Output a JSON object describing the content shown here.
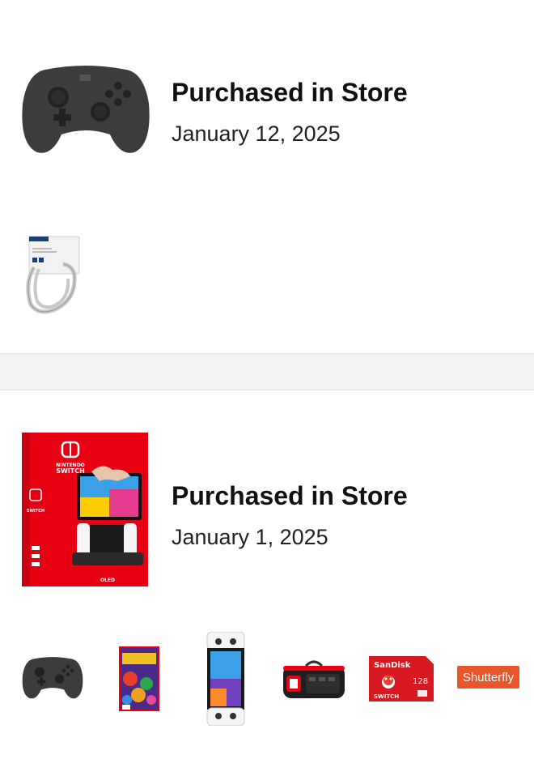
{
  "orders": [
    {
      "title": "Purchased in Store",
      "date": "January 12, 2025",
      "main_product_icon": "pro-controller",
      "items": [
        "ethernet-cable-product"
      ]
    },
    {
      "title": "Purchased in Store",
      "date": "January 1, 2025",
      "main_product_icon": "nintendo-switch-oled-box",
      "box_brand": "NINTENDO SWITCH",
      "box_model": "OLED",
      "items": [
        "pro-controller",
        "mario-kart-8-deluxe-game",
        "switch-oled-console",
        "switch-carry-case",
        "sandisk-microsd-card",
        "shutterfly-gift-card"
      ],
      "sd_brand": "SanDisk",
      "sd_capacity": "128",
      "sd_platform": "SWITCH",
      "shutterfly_label": "Shutterfly"
    }
  ],
  "colors": {
    "box_red": "#e60012",
    "shutterfly_orange": "#e8562a",
    "controller": "#3a3c3e",
    "sandisk_red": "#d71921"
  }
}
